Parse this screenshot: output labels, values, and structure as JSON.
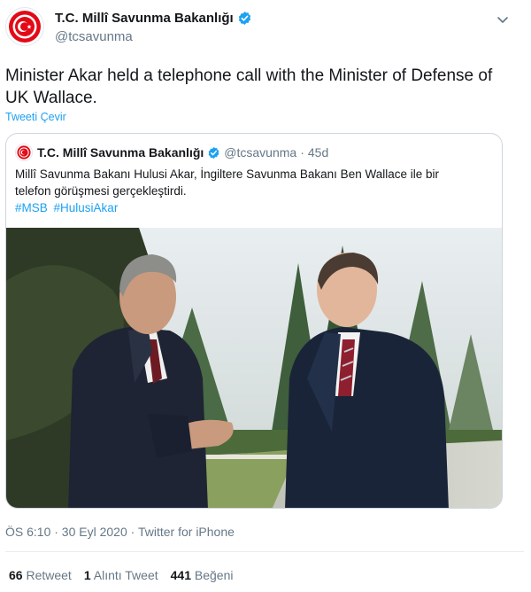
{
  "account": {
    "display_name": "T.C. Millî Savunma Bakanlığı",
    "handle": "@tcsavunma"
  },
  "tweet": {
    "text": "Minister Akar held a telephone call with the Minister of Defense of UK Wallace.",
    "translate_label": "Tweeti Çevir",
    "timestamp": "ÖS 6:10 · 30 Eyl 2020",
    "separator": " · ",
    "source": "Twitter for iPhone"
  },
  "quoted": {
    "display_name": "T.C. Millî Savunma Bakanlığı",
    "handle": "@tcsavunma",
    "dot": "·",
    "age": "45d",
    "text": "Millî Savunma Bakanı Hulusi Akar, İngiltere Savunma Bakanı Ben Wallace ile bir\ntelefon görüşmesi gerçekleştirdi.",
    "hashtags": [
      "#MSB",
      "#HulusiAkar"
    ]
  },
  "stats": {
    "retweets_count": "66",
    "retweets_label": " Retweet",
    "quotes_count": "1",
    "quotes_label": " Alıntı Tweet",
    "likes_count": "441",
    "likes_label": " Beğeni"
  },
  "colors": {
    "link": "#1da1f2",
    "secondary_text": "#657786",
    "logo_red": "#e30a17"
  },
  "icons": [
    "emblem-logo-icon",
    "verified-badge-icon",
    "chevron-down-icon"
  ]
}
